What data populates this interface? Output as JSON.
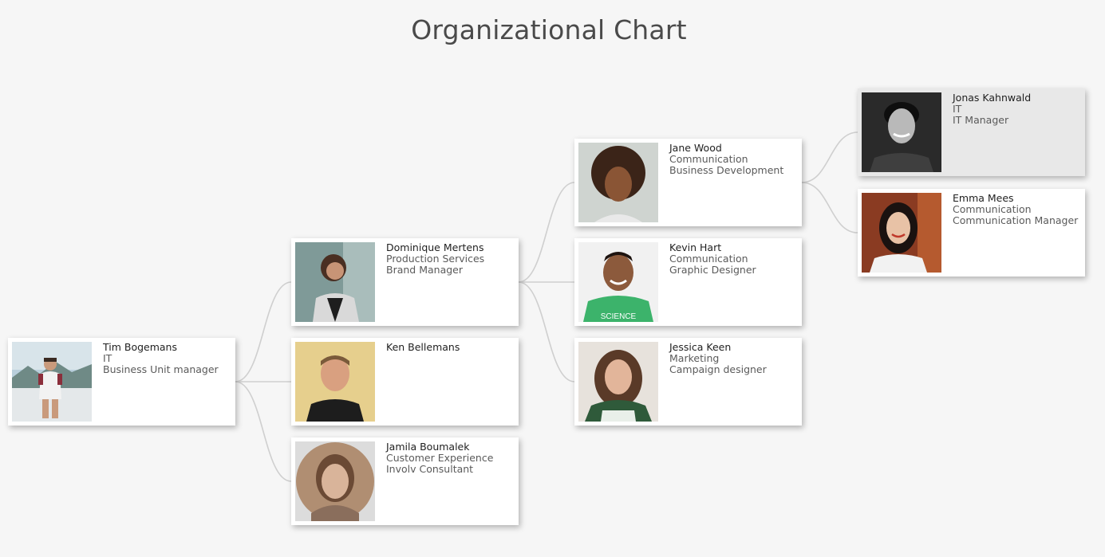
{
  "title": "Organizational Chart",
  "colors": {
    "background": "#f6f6f6",
    "card": "#ffffff",
    "card_highlight": "#e8e8e8",
    "link": "#cfcfcf",
    "title_text": "#4a4a4a"
  },
  "people": {
    "tim": {
      "name": "Tim Bogemans",
      "department": "IT",
      "role": "Business Unit manager",
      "photo_icon": "person-photo"
    },
    "dominique": {
      "name": "Dominique Mertens",
      "department": "Production Services",
      "role": "Brand Manager",
      "photo_icon": "person-photo"
    },
    "ken": {
      "name": "Ken Bellemans",
      "department": "",
      "role": "",
      "photo_icon": "person-photo"
    },
    "jamila": {
      "name": "Jamila Boumalek",
      "department": "Customer Experience",
      "role": "Involv Consultant",
      "photo_icon": "person-photo"
    },
    "jane": {
      "name": "Jane Wood",
      "department": "Communication",
      "role": "Business Development",
      "photo_icon": "person-photo"
    },
    "kevin": {
      "name": "Kevin Hart",
      "department": "Communication",
      "role": "Graphic Designer",
      "photo_icon": "person-photo"
    },
    "jessica": {
      "name": "Jessica Keen",
      "department": "Marketing",
      "role": "Campaign designer",
      "photo_icon": "person-photo"
    },
    "jonas": {
      "name": "Jonas Kahnwald",
      "department": "IT",
      "role": "IT Manager",
      "photo_icon": "person-photo"
    },
    "emma": {
      "name": "Emma Mees",
      "department": "Communication",
      "role": "Communication Manager",
      "photo_icon": "person-photo"
    }
  },
  "hierarchy": {
    "tim": [
      "dominique",
      "ken",
      "jamila"
    ],
    "dominique": [
      "jane",
      "kevin",
      "jessica"
    ],
    "jane": [
      "jonas",
      "emma"
    ]
  }
}
